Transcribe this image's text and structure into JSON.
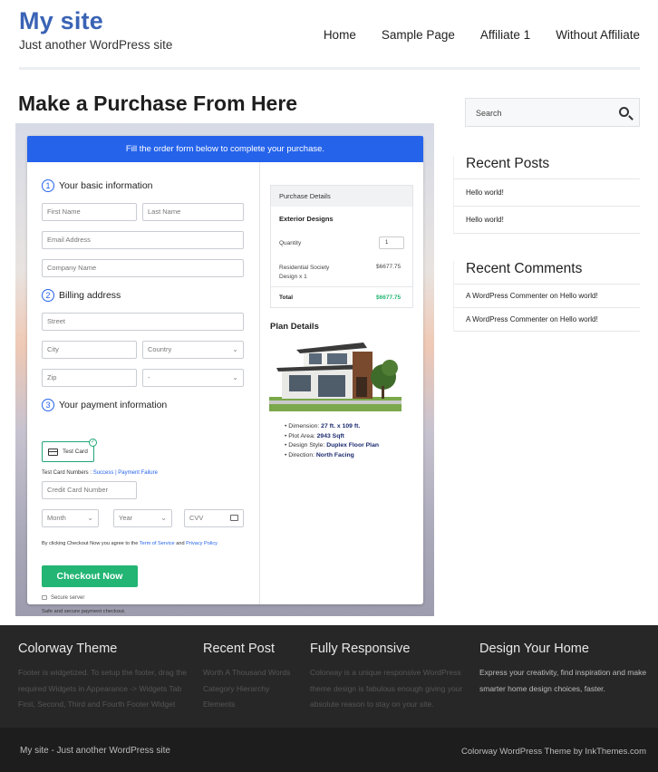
{
  "site": {
    "title": "My site",
    "tagline": "Just another WordPress site"
  },
  "nav": {
    "items": [
      "Home",
      "Sample Page",
      "Affiliate 1",
      "Without Affiliate"
    ]
  },
  "page": {
    "title": "Make a Purchase From Here"
  },
  "checkout": {
    "banner": "Fill the order form below to complete your purchase.",
    "step1": {
      "num": "1",
      "title": "Your basic information"
    },
    "step2": {
      "num": "2",
      "title": "Billing address"
    },
    "step3": {
      "num": "3",
      "title": "Your payment information"
    },
    "fields": {
      "first_name": "First Name",
      "last_name": "Last Name",
      "email": "Email Address",
      "company": "Company Name",
      "street": "Street",
      "city": "City",
      "country": "Country",
      "zip": "Zip",
      "state": "-",
      "card_number": "Credit Card Number",
      "month": "Month",
      "year": "Year",
      "cvv": "CVV"
    },
    "payment_option": "Test Card",
    "test_card_label": "Test Card Numbers :",
    "test_success": "Success",
    "test_sep": "|",
    "test_failure": "Payment Failure",
    "terms_prefix": "By clicking Checkout Now you agree to the",
    "terms_link": "Term of Service",
    "terms_and": "and",
    "privacy_link": "Privacy Policy",
    "button": "Checkout Now",
    "secure": "Secure server",
    "safe": "Safe and secure payment checkout."
  },
  "purchase": {
    "header": "Purchase Details",
    "product": "Exterior Designs",
    "quantity_label": "Quantity",
    "quantity": "1",
    "item_line1": "Residential Society",
    "item_line2": "Design x 1",
    "item_price": "$6677.75",
    "total_label": "Total",
    "total": "$6677.75"
  },
  "plan": {
    "title": "Plan Details",
    "specs": [
      {
        "label": "Dimension:",
        "value": "27 ft. x 109 ft."
      },
      {
        "label": "Plot Area:",
        "value": "2943 Sqft"
      },
      {
        "label": "Design Style:",
        "value": "Duplex Floor Plan"
      },
      {
        "label": "Direction:",
        "value": "North Facing"
      }
    ]
  },
  "sidebar": {
    "search_placeholder": "Search",
    "recent_posts_title": "Recent Posts",
    "recent_posts": [
      "Hello world!",
      "Hello world!"
    ],
    "recent_comments_title": "Recent Comments",
    "recent_comments": [
      {
        "author": "A WordPress Commenter",
        "on": "on",
        "post": "Hello world!"
      },
      {
        "author": "A WordPress Commenter",
        "on": "on",
        "post": "Hello world!"
      }
    ]
  },
  "footer": {
    "col1": {
      "title": "Colorway Theme",
      "text": "Footer is widgetized. To setup the footer, drag the required Widgets in Appearance -> Widgets Tab First, Second, Third and Fourth Footer Widget"
    },
    "col2": {
      "title": "Recent Post",
      "text": "Worth A Thousand Words Category Hierarchy Elements"
    },
    "col3": {
      "title": "Fully Responsive",
      "text": "Colorway is a unique responsive WordPress theme design is fabulous enough giving your absolute reason to stay on your site."
    },
    "col4": {
      "title": "Design Your Home",
      "text": "Express your creativity, find inspiration and make smarter home design choices, faster."
    },
    "bottom_left": "My site - Just another WordPress site",
    "bottom_right": "Colorway WordPress Theme by InkThemes.com"
  },
  "colors": {
    "brand": "#3a63b5",
    "banner": "#2563eb",
    "cta": "#22b573",
    "total": "#22b573",
    "footer": "#272727"
  }
}
